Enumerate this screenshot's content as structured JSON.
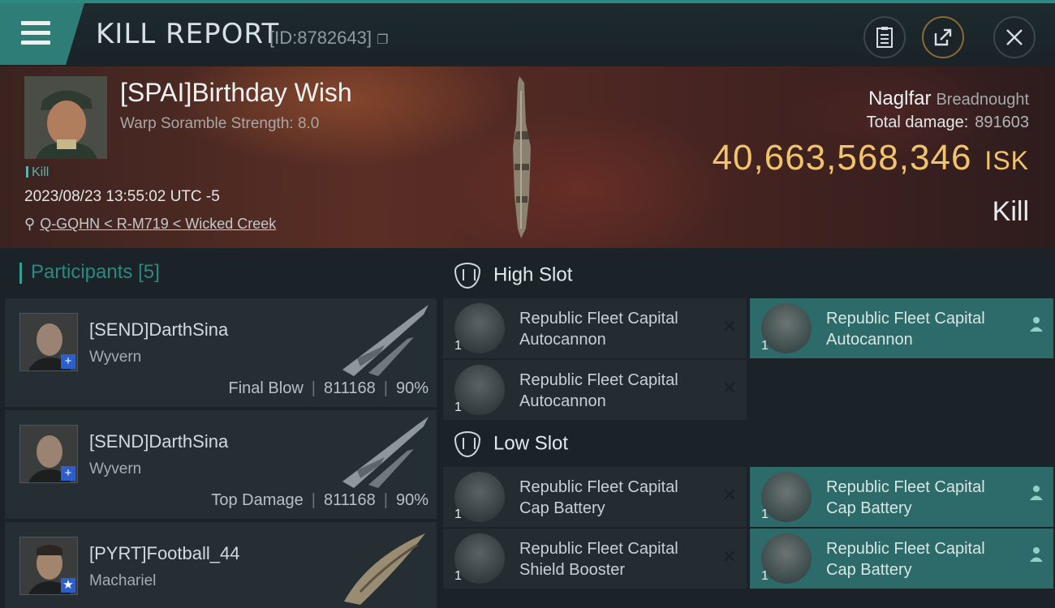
{
  "header": {
    "title": "KILL REPORT",
    "report_id": "[ID:8782643]",
    "menu_icon": "hamburger-icon",
    "icons": [
      "clipboard-icon",
      "share-icon",
      "close-icon"
    ]
  },
  "victim": {
    "name": "[SPAI]Birthday Wish",
    "scramble": "Warp Soramble Strength: 8.0",
    "kill_tag": "Kill",
    "datetime": "2023/08/23 13:55:02 UTC -5",
    "location": "Q-GQHN < R-M719 < Wicked Creek",
    "ship_name": "Naglfar",
    "ship_class": "Breadnought",
    "total_damage_label": "Total damage:",
    "total_damage": "891603",
    "isk_value": "40,663,568,346",
    "isk_unit": "ISK",
    "result": "Kill"
  },
  "participants": {
    "title": "Participants",
    "count": "[5]",
    "items": [
      {
        "name": "[SEND]DarthSina",
        "ship": "Wyvern",
        "role": "Final Blow",
        "damage": "811168",
        "percent": "90%",
        "badge": "+"
      },
      {
        "name": "[SEND]DarthSina",
        "ship": "Wyvern",
        "role": "Top Damage",
        "damage": "811168",
        "percent": "90%",
        "badge": "+"
      },
      {
        "name": "[PYRT]Football_44",
        "ship": "Machariel",
        "role": "",
        "damage": "",
        "percent": "",
        "badge": "★"
      }
    ]
  },
  "slots": {
    "high_label": "High Slot",
    "low_label": "Low Slot",
    "high": [
      {
        "name": "Republic Fleet Capital Autocannon",
        "qty": "1",
        "state": "destroyed"
      },
      {
        "name": "Republic Fleet Capital Autocannon",
        "qty": "1",
        "state": "dropped"
      },
      {
        "name": "Republic Fleet Capital Autocannon",
        "qty": "1",
        "state": "destroyed"
      }
    ],
    "low": [
      {
        "name": "Republic Fleet Capital Cap Battery",
        "qty": "1",
        "state": "destroyed"
      },
      {
        "name": "Republic Fleet Capital Cap Battery",
        "qty": "1",
        "state": "dropped"
      },
      {
        "name": "Republic Fleet Capital Shield Booster",
        "qty": "1",
        "state": "destroyed"
      },
      {
        "name": "Republic Fleet Capital Cap Battery",
        "qty": "1",
        "state": "dropped"
      }
    ]
  },
  "colors": {
    "accent": "#2e7e77",
    "isk": "#f1c36a",
    "fitted_bg": "#2c6b69",
    "panel_bg": "#242c31"
  }
}
